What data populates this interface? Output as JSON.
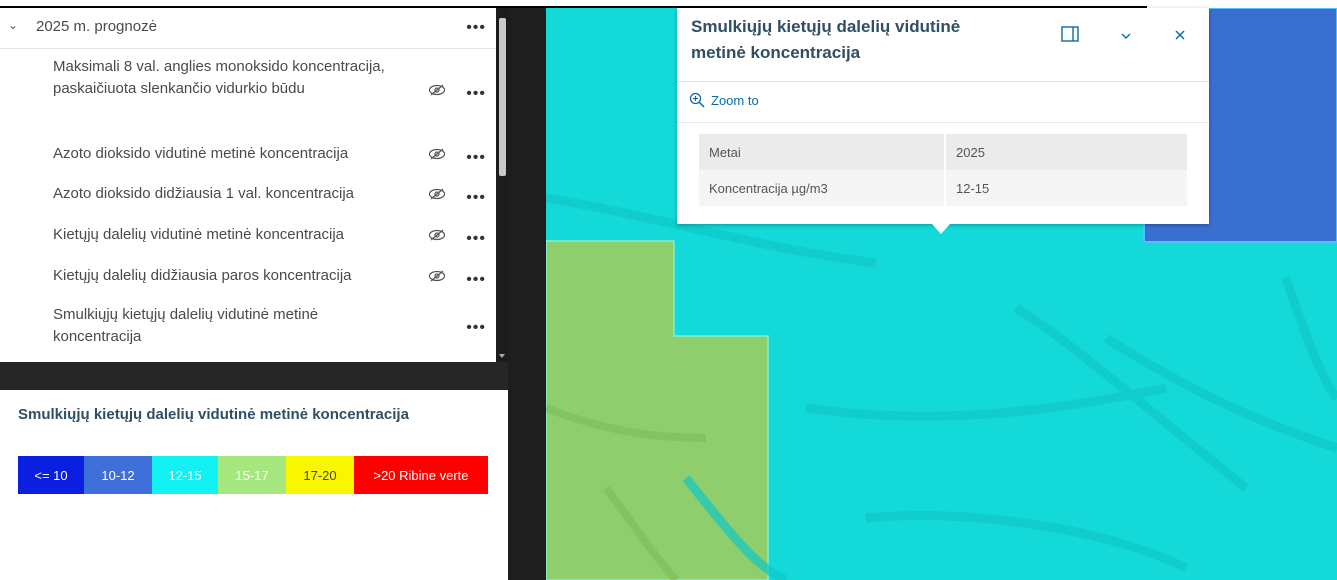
{
  "top_clip": {
    "text": ""
  },
  "layer_group": {
    "title": "2025 m. prognozė",
    "items": [
      {
        "label": "Maksimali 8 val. anglies monoksido koncentracija, paskaičiuota slenkančio vidurkio būdu",
        "visible": false
      },
      {
        "label": "Azoto dioksido vidutinė metinė koncentracija",
        "visible": false
      },
      {
        "label": "Azoto dioksido didžiausia 1 val. koncentracija",
        "visible": false
      },
      {
        "label": "Kietųjų dalelių vidutinė metinė koncentracija",
        "visible": false
      },
      {
        "label": "Kietųjų dalelių didžiausia paros koncentracija",
        "visible": false
      },
      {
        "label": "Smulkiųjų kietųjų dalelių vidutinė metinė koncentracija",
        "visible": true
      }
    ],
    "more_icon": "•••"
  },
  "legend": {
    "title": "Smulkiųjų kietųjų dalelių vidutinė metinė koncentracija",
    "classes": [
      {
        "label": "<= 10",
        "color": "#0b1fe0",
        "text_color": "#ffffff"
      },
      {
        "label": "10-12",
        "color": "#3f6fd8",
        "text_color": "#ffffff"
      },
      {
        "label": "12-15",
        "color": "#12f2f2",
        "text_color": "#ffffff"
      },
      {
        "label": "15-17",
        "color": "#a6e87e",
        "text_color": "#ffffff"
      },
      {
        "label": "17-20",
        "color": "#f8f600",
        "text_color": "#444444"
      },
      {
        "label": ">20 Ribine verte",
        "color": "#ff0000",
        "text_color": "#ffffff"
      }
    ]
  },
  "popup": {
    "title": "Smulkiųjų kietųjų dalelių vidutinė metinė koncentracija",
    "zoom_label": "Zoom to",
    "attributes": [
      {
        "field": "Metai",
        "value": "2025"
      },
      {
        "field": "Koncentracija µg/m3",
        "value": "12-15"
      }
    ]
  },
  "map": {
    "colors": {
      "cyan_zone": "#13d9d9",
      "green_zone": "#8fce6c",
      "blue_zone": "#3a6fd2"
    }
  }
}
